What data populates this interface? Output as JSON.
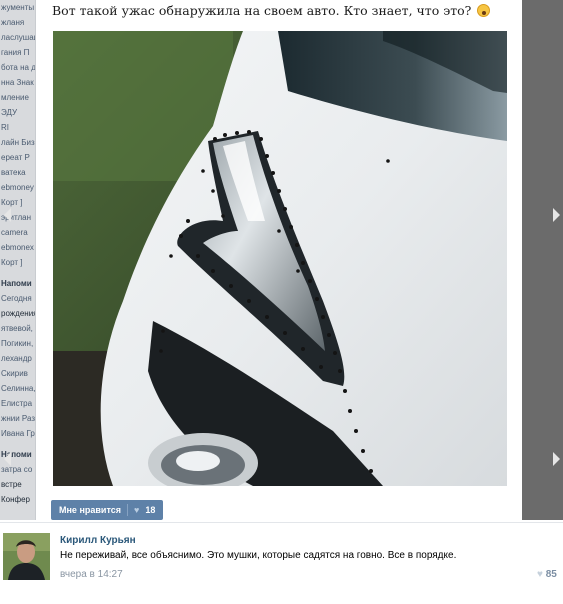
{
  "sidebar": {
    "items": [
      {
        "label": "жументы",
        "style": ""
      },
      {
        "label": "жланя",
        "style": ""
      },
      {
        "label": "лаcлушаи",
        "style": ""
      },
      {
        "label": "гания П",
        "style": ""
      },
      {
        "label": "бота на д",
        "style": ""
      },
      {
        "label": "нна Знак",
        "style": ""
      },
      {
        "label": "мление",
        "style": ""
      },
      {
        "label": "ЭДУ",
        "style": ""
      },
      {
        "label": "RI",
        "style": ""
      },
      {
        "label": "лайн Биз",
        "style": ""
      },
      {
        "label": "ереат Р",
        "style": ""
      },
      {
        "label": "ватека",
        "style": ""
      },
      {
        "label": "ebmoney",
        "style": ""
      },
      {
        "label": "Корт ]",
        "style": ""
      },
      {
        "label": "эритлан",
        "style": ""
      },
      {
        "label": "camera",
        "style": ""
      },
      {
        "label": "ebmonex",
        "style": ""
      },
      {
        "label": "Корт ]",
        "style": ""
      },
      {
        "label": "Напоми",
        "style": "bold"
      },
      {
        "label": "Сегодня",
        "style": ""
      },
      {
        "label": "рождения",
        "style": "dark"
      },
      {
        "label": "ятвевой,",
        "style": ""
      },
      {
        "label": "Погикин,",
        "style": ""
      },
      {
        "label": "лехандр",
        "style": ""
      },
      {
        "label": "Скирив",
        "style": ""
      },
      {
        "label": "Селинна,",
        "style": ""
      },
      {
        "label": "Елистра",
        "style": ""
      },
      {
        "label": "жнии Раз",
        "style": ""
      },
      {
        "label": "Ивана Гр",
        "style": ""
      },
      {
        "label": "Напоми",
        "style": "bold"
      },
      {
        "label": "затра со",
        "style": ""
      },
      {
        "label": "встре",
        "style": "dark"
      },
      {
        "label": "Конфер",
        "style": "dark"
      }
    ]
  },
  "post": {
    "text": "Вот такой ужас обнаружила на своем авто. Кто знает, что это?",
    "emoji": "fearful-face",
    "like_label": "Мне нравится",
    "like_count": "18"
  },
  "comment": {
    "author": "Кирилл Курьян",
    "text": "Не переживай, все объяснимо. Это мушки, которые садятся на говно. Все в порядке.",
    "time": "вчера в 14:27",
    "likes": "85"
  },
  "colors": {
    "link": "#2b587a",
    "like_button": "#5e81a8",
    "overlay": "#6b6b6b"
  }
}
